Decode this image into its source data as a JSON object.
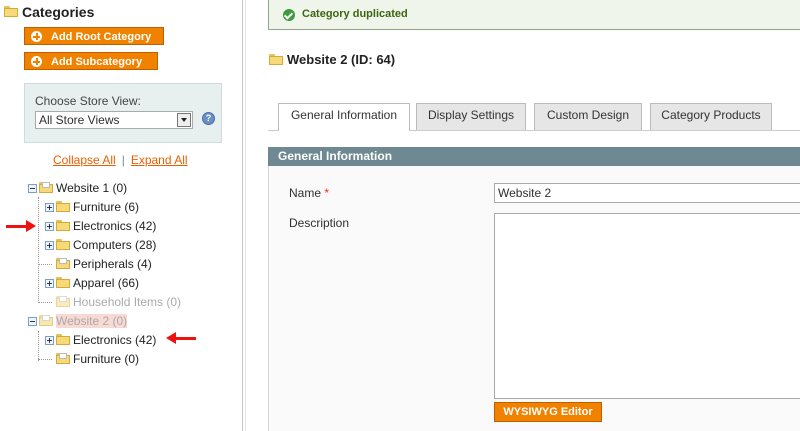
{
  "left_panel": {
    "title": "Categories",
    "add_root_label": "Add Root Category",
    "add_sub_label": "Add Subcategory",
    "store_view_label": "Choose Store View:",
    "store_view_value": "All Store Views",
    "collapse_all": "Collapse All",
    "separator": "|",
    "expand_all": "Expand All",
    "tree": [
      {
        "label": "Website 1 (0)",
        "state": "expanded"
      },
      {
        "label": "Furniture (6)",
        "state": "collapsed"
      },
      {
        "label": "Electronics (42)",
        "state": "collapsed"
      },
      {
        "label": "Computers (28)",
        "state": "collapsed"
      },
      {
        "label": "Peripherals (4)",
        "state": "leaf"
      },
      {
        "label": "Apparel (66)",
        "state": "collapsed"
      },
      {
        "label": "Household Items (0)",
        "state": "leaf-disabled"
      },
      {
        "label": "Website 2 (0)",
        "state": "expanded-selected"
      },
      {
        "label": "Electronics (42)",
        "state": "collapsed"
      },
      {
        "label": "Furniture (0)",
        "state": "leaf"
      }
    ]
  },
  "message": {
    "text": "Category duplicated",
    "type": "success"
  },
  "page_title": "Website 2 (ID: 64)",
  "tabs": [
    {
      "label": "General Information",
      "active": true
    },
    {
      "label": "Display Settings",
      "active": false
    },
    {
      "label": "Custom Design",
      "active": false
    },
    {
      "label": "Category Products",
      "active": false
    }
  ],
  "section": {
    "header": "General Information",
    "name_label": "Name",
    "required_mark": "*",
    "name_value": "Website 2",
    "description_label": "Description",
    "description_value": "",
    "wysiwyg_label": "WYSIWYG Editor"
  },
  "colors": {
    "accent_orange": "#f18200",
    "link_orange": "#eb5e00",
    "section_header": "#6f8992",
    "success_text": "#3d6611",
    "annotation_arrow": "#e11111"
  },
  "icons": [
    "folder-icon",
    "help-icon",
    "success-check-icon",
    "plus-icon",
    "dropdown-arrow-icon",
    "expand-toggle-icon"
  ]
}
